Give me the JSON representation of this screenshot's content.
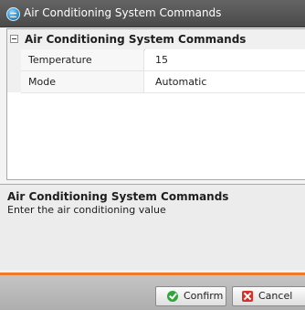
{
  "window": {
    "title": "Air Conditioning System Commands",
    "icon": "app-logo-icon"
  },
  "grid": {
    "group_title": "Air Conditioning System Commands",
    "group_expanded": true,
    "properties": [
      {
        "name": "Temperature",
        "value": "15"
      },
      {
        "name": "Mode",
        "value": "Automatic"
      }
    ]
  },
  "description": {
    "title": "Air Conditioning System Commands",
    "text": "Enter the air conditioning value"
  },
  "footer": {
    "confirm_label": "Confirm",
    "cancel_label": "Cancel"
  },
  "colors": {
    "accent": "#f07a2a",
    "titlebar": "#555555",
    "confirm_icon": "#2fa53a",
    "cancel_icon": "#d9302a"
  }
}
